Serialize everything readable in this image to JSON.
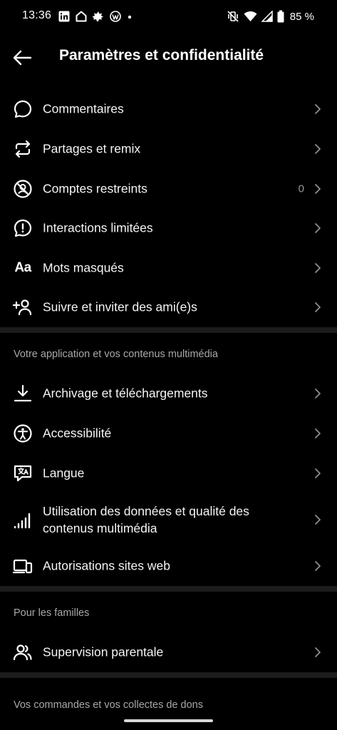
{
  "status_bar": {
    "time": "13:36",
    "battery_percent": "85 %",
    "left_icons": [
      "linkedin-icon",
      "home-icon",
      "leaf-icon",
      "wordpress-icon",
      "dot-icon"
    ],
    "right_icons": [
      "mute-vibrate-icon",
      "wifi-icon",
      "signal-icon",
      "battery-icon"
    ]
  },
  "header": {
    "title": "Paramètres et confidentialité"
  },
  "interactions": [
    {
      "label": "Commentaires",
      "icon": "comment-icon"
    },
    {
      "label": "Partages et remix",
      "icon": "repost-icon"
    },
    {
      "label": "Comptes restreints",
      "icon": "restricted-icon",
      "count": "0"
    },
    {
      "label": "Interactions limitées",
      "icon": "alert-bubble-icon"
    },
    {
      "label": "Mots masqués",
      "icon": "text-aa-icon",
      "icon_text": "Aa"
    },
    {
      "label": "Suivre et inviter des ami(e)s",
      "icon": "add-person-icon"
    }
  ],
  "app_section": {
    "title": "Votre application et vos contenus multimédia",
    "items": [
      {
        "label": "Archivage et téléchargements",
        "icon": "download-icon"
      },
      {
        "label": "Accessibilité",
        "icon": "accessibility-icon"
      },
      {
        "label": "Langue",
        "icon": "translate-icon"
      },
      {
        "label": "Utilisation des données et qualité des contenus multimédia",
        "icon": "signal-bars-icon"
      },
      {
        "label": "Autorisations sites web",
        "icon": "devices-icon"
      }
    ]
  },
  "family_section": {
    "title": "Pour les familles",
    "items": [
      {
        "label": "Supervision parentale",
        "icon": "supervision-icon"
      }
    ]
  },
  "orders_section": {
    "title": "Vos commandes et vos collectes de dons"
  },
  "colors": {
    "background": "#000000",
    "divider": "#1c1c1c",
    "text_primary": "#f5f5f5",
    "text_secondary": "#a8a8a8"
  }
}
